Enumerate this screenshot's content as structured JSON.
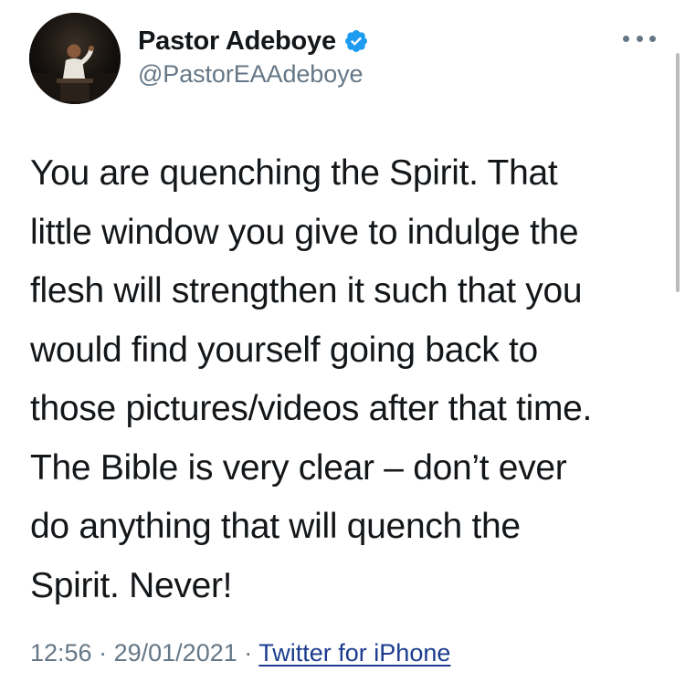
{
  "author": {
    "display_name": "Pastor Adeboye",
    "handle": "@PastorEAAdeboye",
    "verified": true,
    "avatar": "profile-photo"
  },
  "tweet": {
    "lines": [
      "You are quenching the Spirit. That",
      "little window you give to indulge the",
      "flesh will strengthen it such that you",
      "would find yourself going back to",
      "those pictures/videos after that time.",
      "The Bible is very clear – don’t ever",
      "do anything that will quench the",
      "Spirit. Never!"
    ]
  },
  "meta": {
    "time": "12:56",
    "separator": "·",
    "date": "29/01/2021",
    "source": "Twitter for iPhone"
  },
  "icons": {
    "verified": "verified-badge-icon",
    "more": "more-options-icon"
  },
  "colors": {
    "verified_badge": "#1d9bf0",
    "link": "#1b3c8e",
    "secondary_text": "#657786",
    "primary_text": "#14171a"
  }
}
